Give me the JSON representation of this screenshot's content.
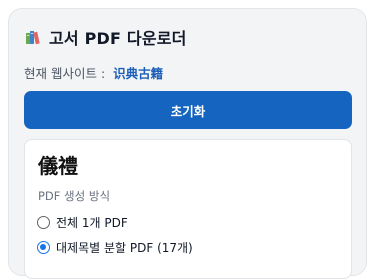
{
  "header": {
    "icon": "books-icon",
    "title": "고서 PDF 다운로더"
  },
  "site": {
    "label": "현재 웹사이트",
    "separator": ":",
    "name": "识典古籍"
  },
  "actions": {
    "reset_label": "초기화"
  },
  "book": {
    "title": "儀禮",
    "mode_label": "PDF 생성 방식",
    "options": [
      {
        "label": "전체 1개 PDF",
        "selected": false
      },
      {
        "label": "대제목별 분할 PDF (17개)",
        "selected": true
      }
    ]
  },
  "colors": {
    "accent": "#1565c0",
    "site_link": "#1d5fb8",
    "radio_selected": "#1a73e8",
    "panel_bg": "#f3f4f6"
  }
}
